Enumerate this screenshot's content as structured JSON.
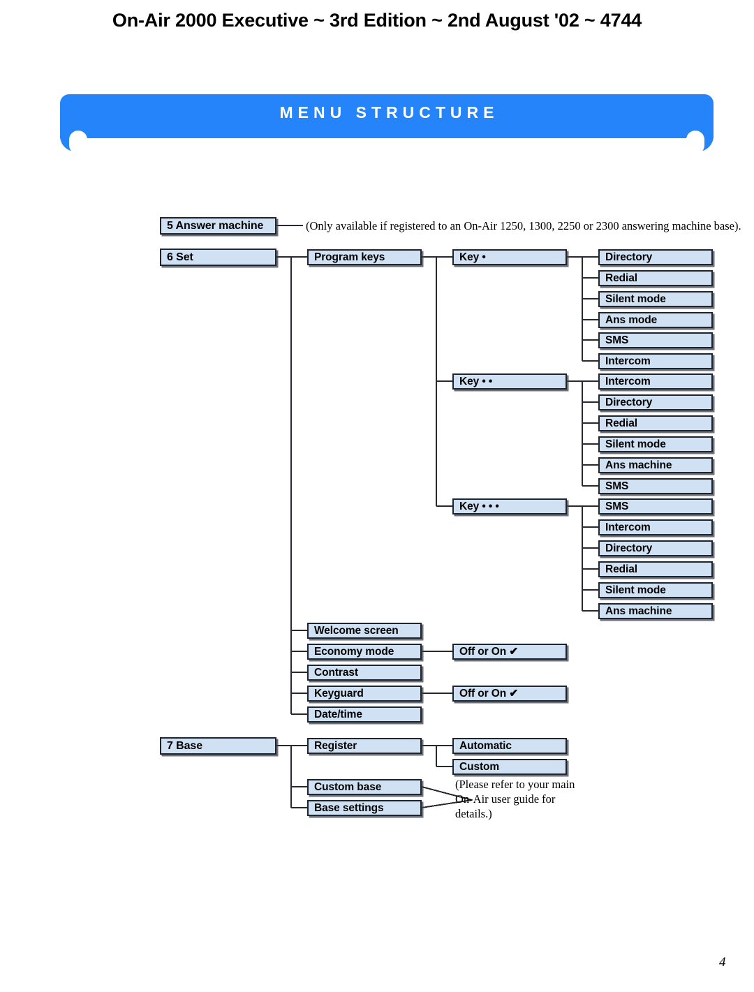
{
  "header": {
    "title": "On-Air 2000 Executive ~ 3rd Edition ~ 2nd August '02 ~ 4744"
  },
  "banner": {
    "title": "MENU STRUCTURE",
    "color": "#2684fa"
  },
  "page": {
    "number": "4",
    "box_fill": "#cfe1f3",
    "box_border": "#20242c"
  },
  "diagram": {
    "nodes": {
      "answer_machine": "5 Answer machine",
      "set": "6 Set",
      "program_keys": "Program keys",
      "key1": "Key •",
      "key2": "Key • •",
      "key3": "Key • • •",
      "welcome_screen": "Welcome screen",
      "economy_mode": "Economy mode",
      "economy_value": "Off or On ✔",
      "contrast": "Contrast",
      "keyguard": "Keyguard",
      "keyguard_value": "Off or On ✔",
      "date_time": "Date/time",
      "base": "7 Base",
      "register": "Register",
      "automatic": "Automatic",
      "custom": "Custom",
      "custom_base": "Custom base",
      "base_settings": "Base settings"
    },
    "key1_options": [
      "Directory",
      "Redial",
      "Silent mode",
      "Ans mode",
      "SMS",
      "Intercom"
    ],
    "key2_options": [
      "Intercom",
      "Directory",
      "Redial",
      "Silent mode",
      "Ans machine",
      "SMS"
    ],
    "key3_options": [
      "SMS",
      "Intercom",
      "Directory",
      "Redial",
      "Silent mode",
      "Ans machine"
    ],
    "notes": {
      "answer_machine": "(Only available if registered to an On-Air 1250, 1300, 2250 or 2300 answering machine base).",
      "base_guide": "(Please refer to your main On-Air user guide for details.)"
    }
  }
}
